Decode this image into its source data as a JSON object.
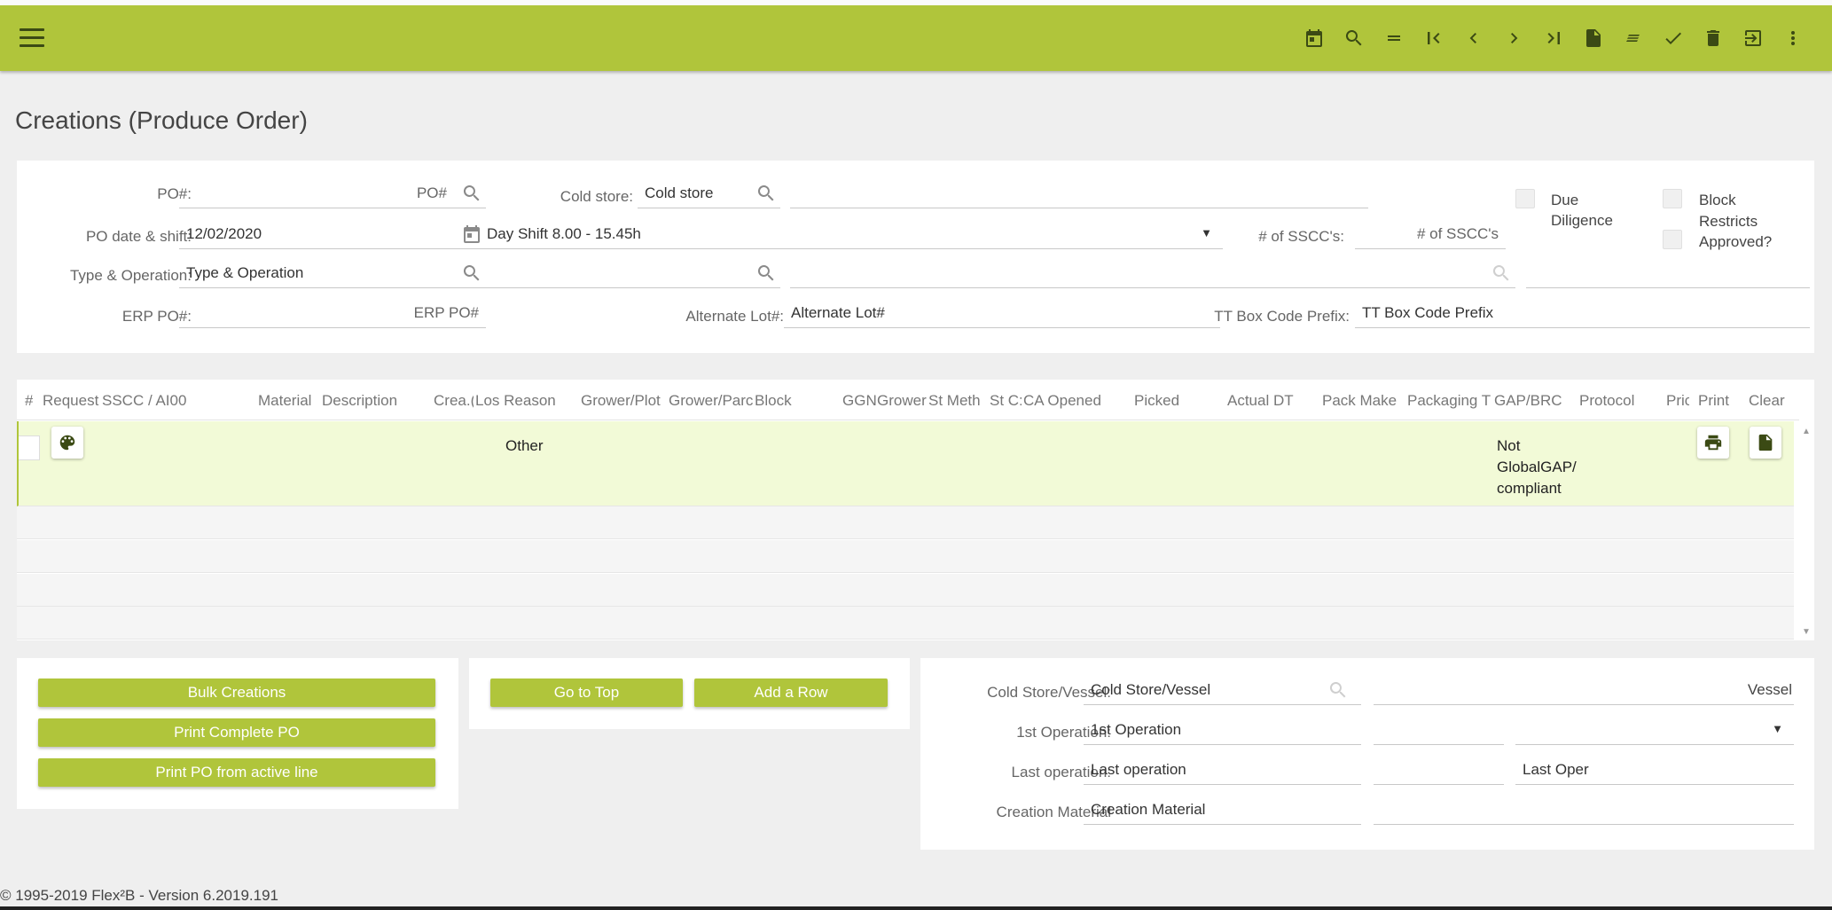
{
  "toolbar": {
    "icons": [
      "menu-icon",
      "calendar-icon",
      "search-icon",
      "equals-icon",
      "first-record-icon",
      "previous-record-icon",
      "next-record-icon",
      "last-record-icon",
      "new-document-icon",
      "notes-icon",
      "confirm-icon",
      "delete-icon",
      "exit-icon",
      "more-icon"
    ],
    "accent": "#b0c53b"
  },
  "page": {
    "title": "Creations (Produce Order)"
  },
  "header": {
    "po_label": "PO#:",
    "po_placeholder": "PO#",
    "cold_store_label": "Cold store:",
    "cold_store_value": "Cold store",
    "po_date_label": "PO date & shift:",
    "po_date_value": "12/02/2020",
    "shift_value": "Day Shift 8.00 - 15.45h",
    "sscc_label": "# of SSCC's:",
    "sscc_placeholder": "# of SSCC's",
    "type_label": "Type & Operation:",
    "type_value": "Type & Operation",
    "erp_label": "ERP PO#:",
    "erp_placeholder": "ERP PO#",
    "alt_lot_label": "Alternate Lot#:",
    "alt_lot_value": "Alternate Lot#",
    "tt_label": "TT Box Code Prefix:",
    "tt_value": "TT Box Code Prefix",
    "due_diligence_label": "Due Diligence",
    "block_label": "Block",
    "restricts_label": "Restricts Approved?"
  },
  "grid": {
    "columns": [
      "#",
      "Request",
      "SSCC / AI00",
      "Material",
      "Description",
      "Crea.(",
      "Los Reason",
      "Grower/Plot",
      "Grower/Parc",
      "Block",
      "GGN",
      "Grower",
      "St Meth",
      "St C:",
      "CA Opened",
      "Picked",
      "Actual DT",
      "Pack Make",
      "Packaging T",
      "GAP/BRC",
      "Protocol",
      "Pric",
      "Print",
      "Clear"
    ],
    "rows": [
      {
        "loss_reason": "Other",
        "gap_brc": "Not GlobalGAP/ compliant"
      }
    ]
  },
  "buttons": {
    "bulk": "Bulk Creations",
    "print_complete": "Print Complete PO",
    "print_active": "Print PO from active line",
    "go_top": "Go to Top",
    "add_row": "Add a Row"
  },
  "form": {
    "cold_store_vessel_label": "Cold Store/Vessel:",
    "cold_store_vessel_value": "Cold Store/Vessel",
    "vessel_value": "Vessel",
    "first_op_label": "1st Operation:",
    "first_op_value": "1st Operation",
    "last_op_label": "Last operation:",
    "last_op_value": "Last operation",
    "last_oper_value": "Last Oper",
    "creation_material_label": "Creation Material",
    "creation_material_value": "Creation Material"
  },
  "footer": {
    "text": "© 1995-2019 Flex²B - Version 6.2019.191"
  }
}
